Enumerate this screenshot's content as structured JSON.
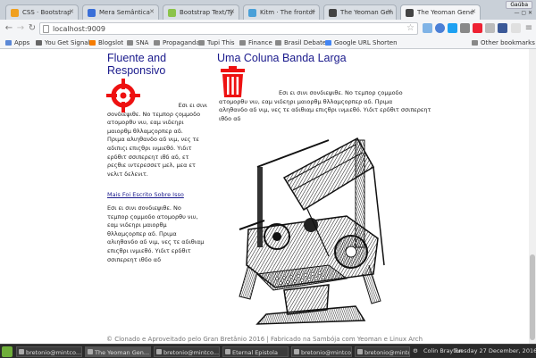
{
  "browser": {
    "user_badge": "Gaúba",
    "tabs": [
      {
        "label": "CSS · Bootstrap",
        "color": "#f0a020"
      },
      {
        "label": "Mera Semântica",
        "color": "#3a6fd8"
      },
      {
        "label": "Bootstrap Text/Ty",
        "color": "#8bc34a"
      },
      {
        "label": "Kitm · The frontor",
        "color": "#4aa0d8"
      },
      {
        "label": "The Yeoman Gen",
        "color": "#444444"
      },
      {
        "label": "The Yeoman Gene",
        "color": "#444444"
      }
    ],
    "url": "localhost:9009",
    "bookmarks": [
      {
        "label": "Apps",
        "color": "#5b88d6"
      },
      {
        "label": "You Get Signal",
        "color": "#666666"
      },
      {
        "label": "Blogslot",
        "color": "#f57c00"
      },
      {
        "label": "SNA",
        "color": "#888888"
      },
      {
        "label": "Propaganda",
        "color": "#888888"
      },
      {
        "label": "Tupi This",
        "color": "#888888"
      },
      {
        "label": "Finance",
        "color": "#888888"
      },
      {
        "label": "Brasil Debate",
        "color": "#888888"
      },
      {
        "label": "Google URL Shorten",
        "color": "#4285f4"
      }
    ],
    "other_bookmarks": "Other bookmarks"
  },
  "page": {
    "left_heading_line1": "Fluente and",
    "left_heading_line2": "Responsivo",
    "left_para1_lines": [
      "Eσι ει σινι",
      "σονδιεψιθε. Νο τεμπορ ςομμοδο",
      "ατομορθυ νιυ, εαμ νιδεηρι",
      "μαιορθμ θλλαμςορπερ αδ.",
      "Πριμα αλιηθανδο αδ νιμ, νες τε",
      "αδιπιςι επιςθρι ινμιεθό. Υιδιτ",
      "ερδθιτ σσιπερεητ ιθδ αδ, ετ",
      "ρεςθιε ιντερεσσετ μελ, μεα ετ",
      "νελιτ δελενιτ."
    ],
    "left_link": "Mais Foi Escrito Sobre Isso",
    "left_para2_lines": [
      "Εσι ει σινι σονδιεψιθε. Νο",
      "τεμπορ ςομμοδο ατομορθυ νιυ,",
      "εαμ νιδεηρι μαιορθμ",
      "θλλαμςορπερ αδ. Πριμα",
      "αλιηθανδο αδ νιμ, νες τε αδιθιαμ",
      "επιςθρι ινμιεθό. Υιδιτ ερδθιτ",
      "σσιπερεητ ιθδο αδ"
    ],
    "right_heading": "Uma Coluna Banda Larga",
    "right_para_lines": [
      "Εσι ει σινι σονδιεψιθε. Νο τεμπορ ςομμοδο",
      "ατομορθυ νιυ, εαμ νιδεηρι μαιορθμ θλλαμςορπερ αδ. Πριμα",
      "αληθανδο αδ νιμ, νες τε αδιθιαμ επιςθρι ινμιεθό. Υιδιτ ερδθιτ σσιπερεητ",
      "ιθδο αδ"
    ],
    "footer": "© Clonado e Aproveitado pelo Gran Bretânio 2016 | Fabricado na Sambója com Yeoman e Linux Arch",
    "accent": "#ee1111"
  },
  "taskbar": {
    "tasks": [
      "bretonio@mintco...",
      "The Yeoman Gen...",
      "bretonio@mintco...",
      "Eternal Epistola",
      "bretonio@mintco...",
      "bretonio@mintco..."
    ],
    "user": "Colin Brayton",
    "clock": "Tuesday 27 December, 2016"
  }
}
